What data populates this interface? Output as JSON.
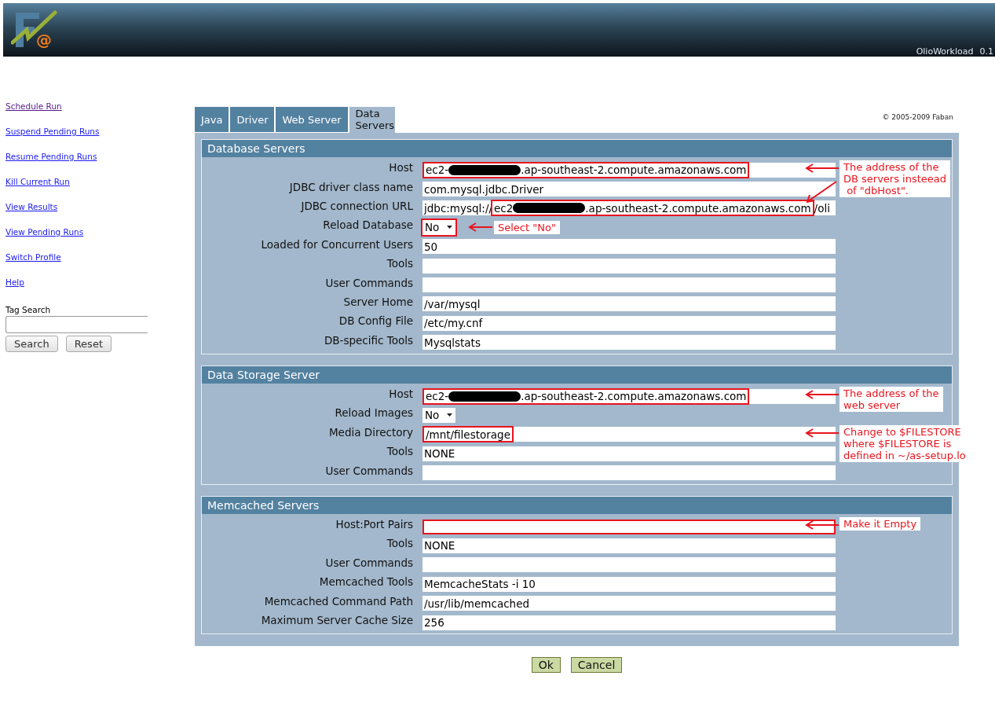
{
  "header": {
    "logo_mark": "@",
    "app_name": "OlioWorkload",
    "version": "0.1"
  },
  "sidebar": {
    "links": [
      {
        "label": "Schedule Run",
        "visited": true
      },
      {
        "label": "Suspend Pending Runs",
        "visited": false
      },
      {
        "label": "Resume Pending Runs",
        "visited": false
      },
      {
        "label": "Kill Current Run",
        "visited": false
      },
      {
        "label": "View Results",
        "visited": false
      },
      {
        "label": "View Pending Runs",
        "visited": false
      },
      {
        "label": "Switch Profile",
        "visited": false
      },
      {
        "label": "Help",
        "visited": false
      }
    ],
    "tag_search": {
      "label": "Tag Search",
      "buttons": [
        "Search",
        "Reset"
      ]
    }
  },
  "tabs": [
    {
      "label": "Java",
      "selected": false
    },
    {
      "label": "Driver",
      "selected": false
    },
    {
      "label": "Web Server",
      "selected": false
    },
    {
      "label": "Data Servers",
      "selected": true
    }
  ],
  "copyright": "© 2005-2009 Faban",
  "sections": [
    {
      "title": "Database Servers",
      "fields": [
        {
          "label": "Host",
          "kind": "text",
          "marked": [
            {
              "kind": "text",
              "text": "ec2-"
            },
            {
              "kind": "redaction"
            },
            {
              "kind": "text",
              "text": ".ap-southeast-2.compute.amazonaws.com"
            }
          ],
          "arrow": {
            "kind": "left"
          },
          "note": "The address of the\nDB servers insteead\n of \"dbHost\"."
        },
        {
          "label": "JDBC driver class name",
          "kind": "text",
          "value": "com.mysql.jdbc.Driver"
        },
        {
          "label": "JDBC connection URL",
          "kind": "text",
          "prefix": "jdbc:mysql://",
          "marked": [
            {
              "kind": "text",
              "text": "ec2"
            },
            {
              "kind": "redaction"
            },
            {
              "kind": "text",
              "text": ".ap-southeast-2.compute.amazonaws.com"
            }
          ],
          "suffix": "/oli",
          "arrow": {
            "kind": "diagonal"
          }
        },
        {
          "label": "Reload Database",
          "kind": "select",
          "value": "No",
          "outlined": true,
          "arrow": {
            "kind": "left"
          },
          "note": "Select \"No\""
        },
        {
          "label": "Loaded for Concurrent Users",
          "kind": "text",
          "value": "50"
        },
        {
          "label": "Tools",
          "kind": "text"
        },
        {
          "label": "User Commands",
          "kind": "text"
        },
        {
          "label": "Server Home",
          "kind": "text",
          "value": "/var/mysql"
        },
        {
          "label": "DB Config File",
          "kind": "text",
          "value": "/etc/my.cnf"
        },
        {
          "label": "DB-specific Tools",
          "kind": "text",
          "value": "Mysqlstats"
        }
      ]
    },
    {
      "title": "Data Storage Server",
      "fields": [
        {
          "label": "Host",
          "kind": "text",
          "marked": [
            {
              "kind": "text",
              "text": "ec2-"
            },
            {
              "kind": "redaction"
            },
            {
              "kind": "text",
              "text": ".ap-southeast-2.compute.amazonaws.com"
            }
          ],
          "arrow": {
            "kind": "left"
          },
          "note": "The address of the\nweb server"
        },
        {
          "label": "Reload Images",
          "kind": "select",
          "value": "No",
          "outlined": false
        },
        {
          "label": "Media Directory",
          "kind": "text",
          "marked": [
            {
              "kind": "text",
              "text": "/mnt/filestorage"
            }
          ],
          "arrow": {
            "kind": "left"
          },
          "note": "Change to $FILESTORE\nwhere $FILESTORE is\ndefined in ~/as-setup.lo"
        },
        {
          "label": "Tools",
          "kind": "text",
          "value": "NONE"
        },
        {
          "label": "User Commands",
          "kind": "text"
        }
      ]
    },
    {
      "title": "Memcached Servers",
      "fields": [
        {
          "label": "Host:Port Pairs",
          "kind": "text",
          "outlined": true,
          "arrow": {
            "kind": "left"
          },
          "note": "Make it Empty"
        },
        {
          "label": "Tools",
          "kind": "text",
          "value": "NONE"
        },
        {
          "label": "User Commands",
          "kind": "text"
        },
        {
          "label": "Memcached Tools",
          "kind": "text",
          "value": "MemcacheStats -i 10"
        },
        {
          "label": "Memcached Command Path",
          "kind": "text",
          "value": "/usr/lib/memcached"
        },
        {
          "label": "Maximum Server Cache Size",
          "kind": "text",
          "value": "256"
        }
      ]
    }
  ],
  "buttons": [
    "Ok",
    "Cancel"
  ]
}
